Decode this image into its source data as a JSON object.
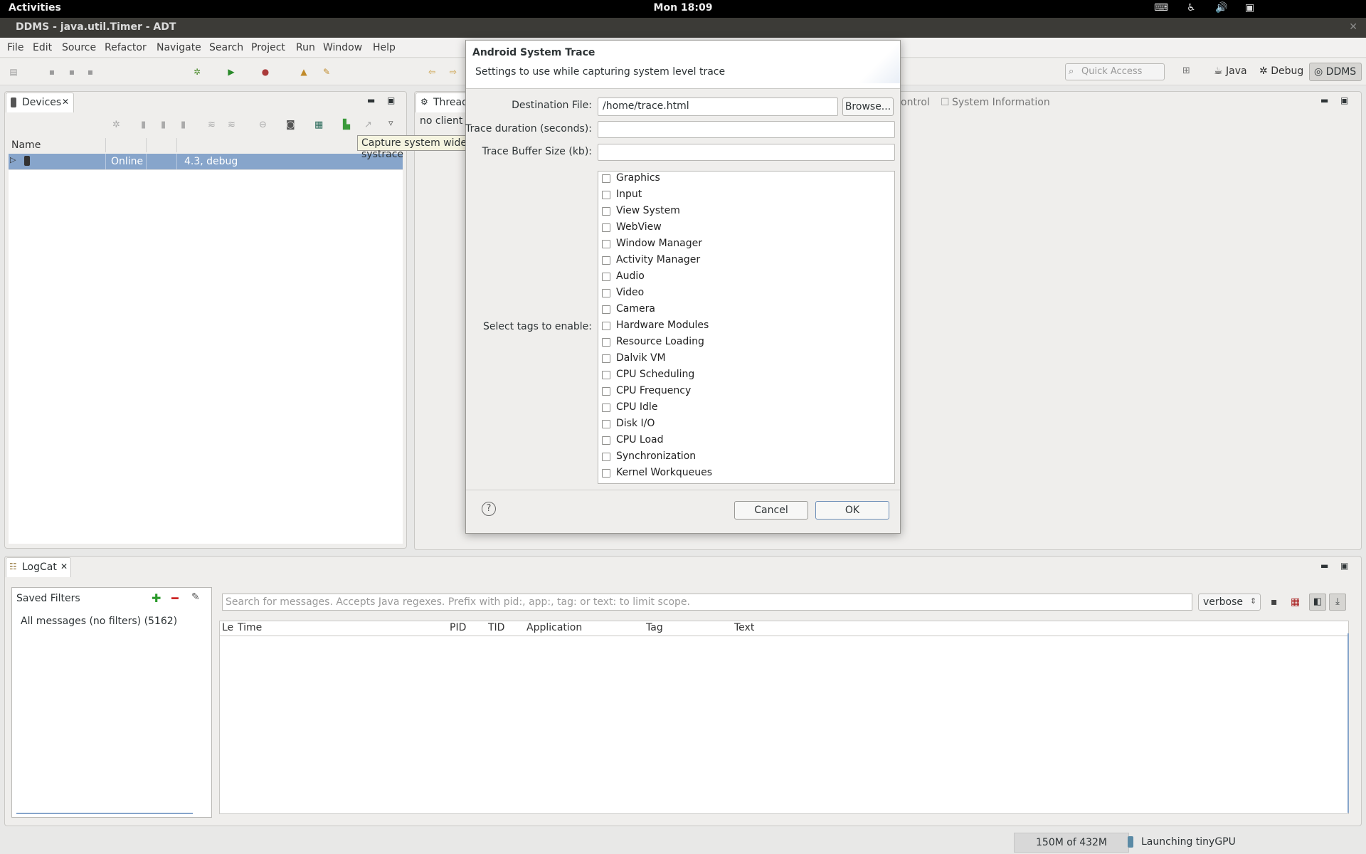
{
  "topbar": {
    "activities": "Activities",
    "clock": "Mon 18:09"
  },
  "window": {
    "title": "DDMS - java.util.Timer - ADT"
  },
  "menu": [
    "File",
    "Edit",
    "Source",
    "Refactor",
    "Navigate",
    "Search",
    "Project",
    "Run",
    "Window",
    "Help"
  ],
  "toolbar": {
    "quick_access_placeholder": "Quick Access"
  },
  "perspectives": {
    "java": "Java",
    "debug": "Debug",
    "ddms": "DDMS"
  },
  "devices": {
    "tab_label": "Devices",
    "columns": [
      "Name",
      "",
      "",
      ""
    ],
    "rows": [
      {
        "status": "Online",
        "version": "4.3, debug"
      }
    ]
  },
  "threads": {
    "tab_label": "Thread",
    "content": "no client i",
    "tab_control": "ontrol",
    "tab_system_info": "System Information"
  },
  "tooltip": "Capture system wide trace using Android systrace",
  "dialog": {
    "title": "Android System Trace",
    "subtitle": "Settings to use while capturing system level trace",
    "destination_label": "Destination File:",
    "destination_value": "/home/trace.html",
    "browse_label": "Browse...",
    "duration_label": "Trace duration (seconds):",
    "duration_value": "",
    "buffer_label": "Trace Buffer Size (kb):",
    "buffer_value": "",
    "tags_label": "Select tags to enable:",
    "tags": [
      "Graphics",
      "Input",
      "View System",
      "WebView",
      "Window Manager",
      "Activity Manager",
      "Audio",
      "Video",
      "Camera",
      "Hardware Modules",
      "Resource Loading",
      "Dalvik VM",
      "CPU Scheduling",
      "CPU Frequency",
      "CPU Idle",
      "Disk I/O",
      "CPU Load",
      "Synchronization",
      "Kernel Workqueues"
    ],
    "cancel_label": "Cancel",
    "ok_label": "OK"
  },
  "logcat": {
    "tab_label": "LogCat",
    "saved_filters_label": "Saved Filters",
    "all_messages": "All messages (no filters) (5162)",
    "search_placeholder": "Search for messages. Accepts Java regexes. Prefix with pid:, app:, tag: or text: to limit scope.",
    "level": "verbose",
    "columns": [
      "Le",
      "Time",
      "PID",
      "TID",
      "Application",
      "Tag",
      "Text"
    ]
  },
  "status": {
    "memory": "150M of 432M",
    "task": "Launching tinyGPU"
  }
}
